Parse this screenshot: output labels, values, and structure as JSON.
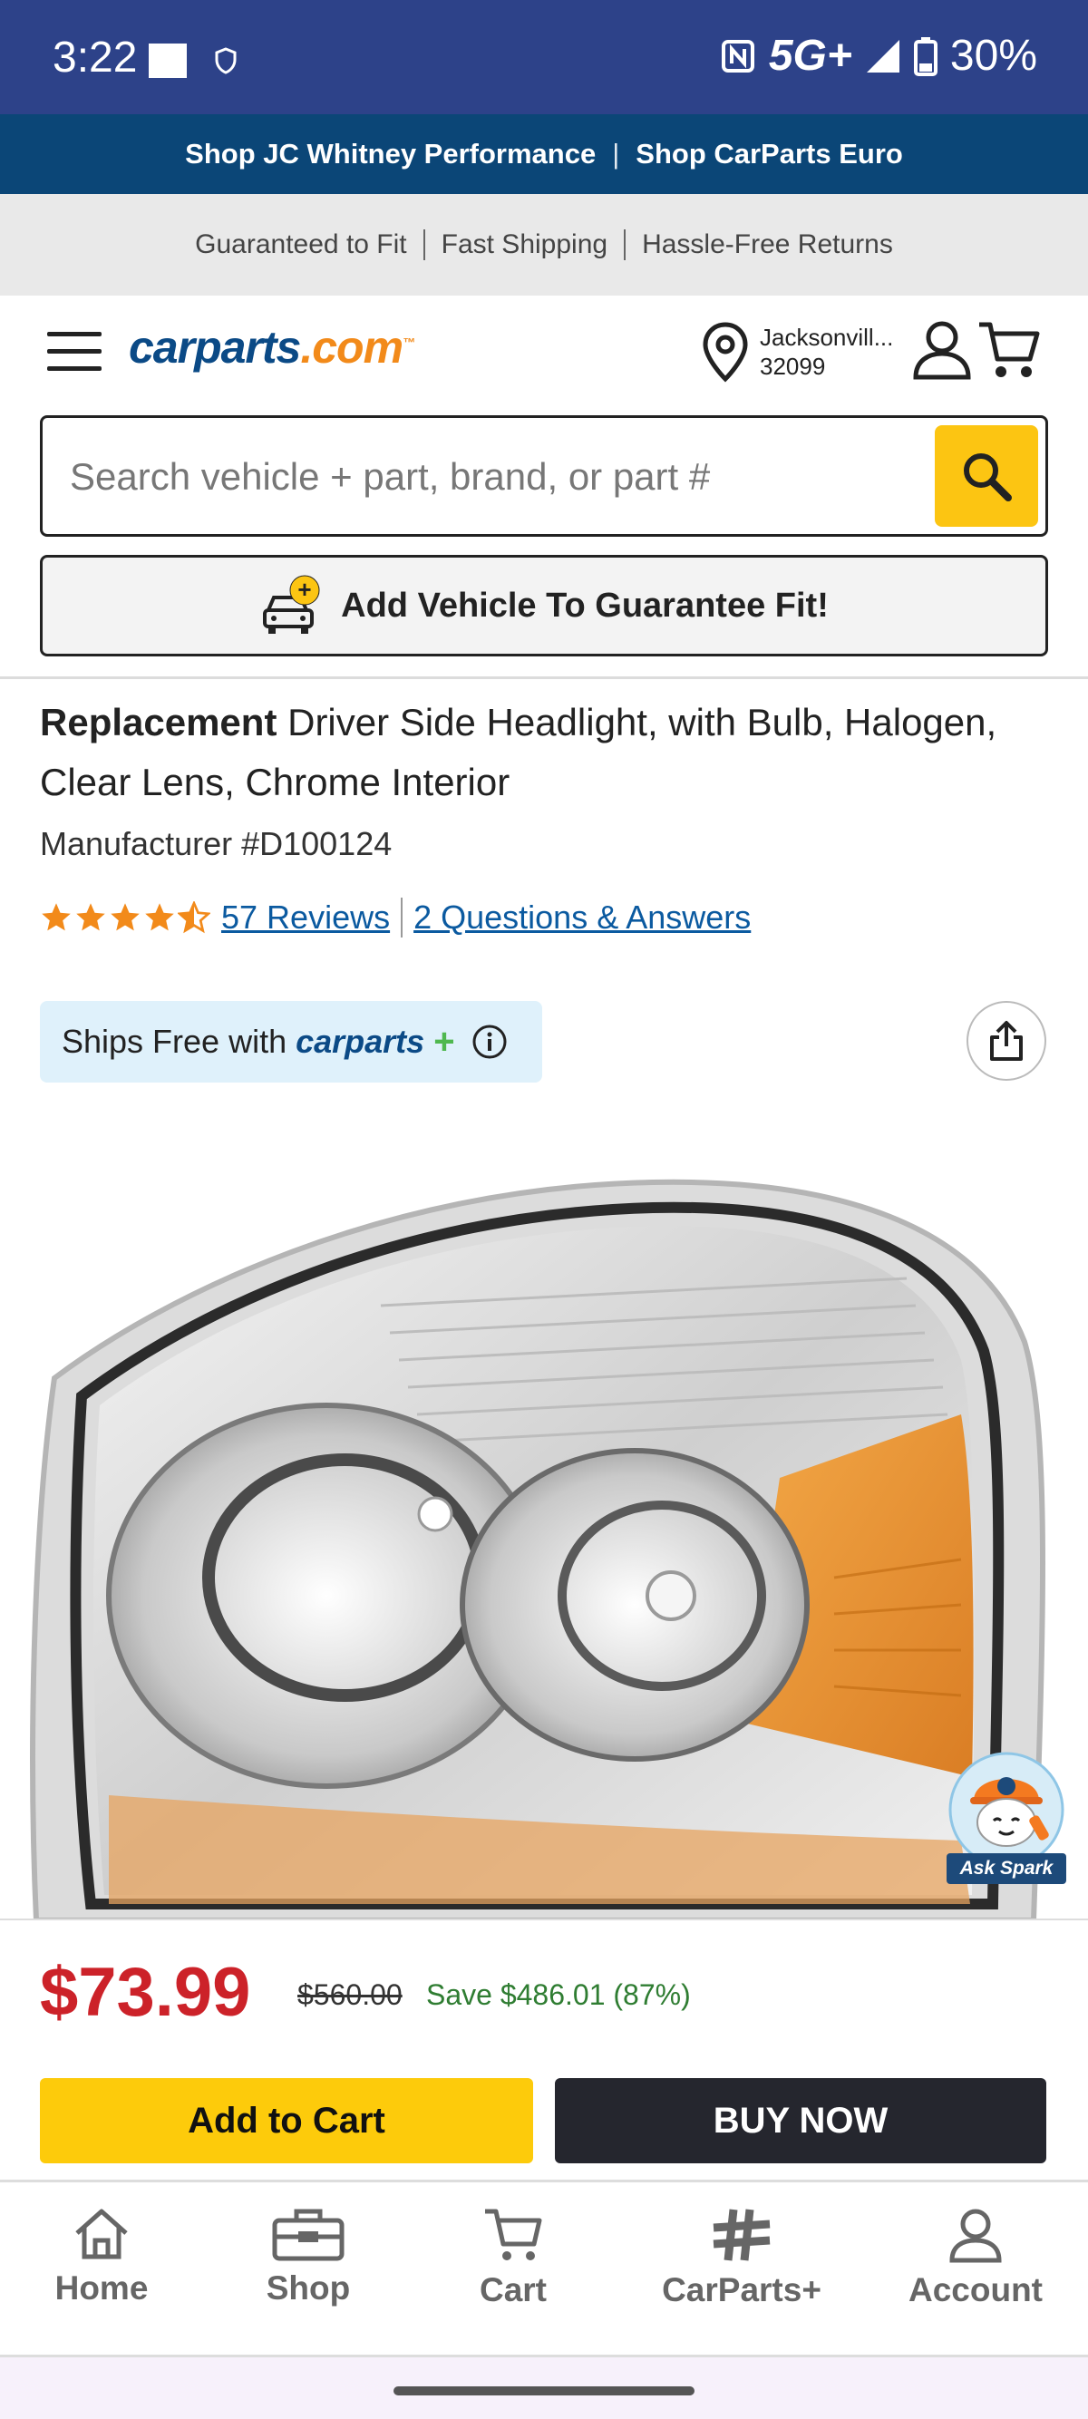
{
  "status_bar": {
    "time": "3:22",
    "network": "5G+",
    "battery": "30%"
  },
  "promo": {
    "link1": "Shop JC Whitney Performance",
    "separator": "|",
    "link2": "Shop CarParts Euro"
  },
  "trust": {
    "item1": "Guaranteed to Fit",
    "item2": "Fast Shipping",
    "item3": "Hassle-Free Returns"
  },
  "header": {
    "logo_main": "carparts",
    "logo_suffix": ".com",
    "logo_tm": "™",
    "location_city": "Jacksonvill...",
    "location_zip": "32099"
  },
  "search": {
    "placeholder": "Search vehicle + part, brand, or part #"
  },
  "add_vehicle": {
    "label": "Add Vehicle To Guarantee Fit!",
    "badge": "+"
  },
  "product": {
    "brand": "Replacement",
    "title": "Driver Side Headlight, with Bulb, Halogen, Clear Lens, Chrome Interior",
    "manufacturer_number": "Manufacturer #D100124",
    "rating": 4.5,
    "rating_max": 5,
    "reviews_link": "57 Reviews",
    "qa_link": "2 Questions & Answers",
    "ships_free_text": "Ships Free with",
    "ships_free_logo": "carparts",
    "ships_free_plus": "+"
  },
  "spark": {
    "label": "Ask Spark"
  },
  "pricing": {
    "price": "$73.99",
    "old_price": "$560.00",
    "savings": "Save $486.01 (87%)",
    "add_to_cart": "Add to Cart",
    "buy_now": "BUY NOW"
  },
  "bottom_nav": {
    "home": "Home",
    "shop": "Shop",
    "cart": "Cart",
    "carparts_plus": "CarParts+",
    "account": "Account"
  },
  "colors": {
    "status_bar": "#2d4289",
    "promo_bar": "#0b4677",
    "brand_blue": "#0b4a86",
    "brand_orange": "#f28a1a",
    "accent_yellow": "#fcc512",
    "price_red": "#cc2229",
    "save_green": "#2f7d32",
    "star_orange": "#f28a1a"
  }
}
